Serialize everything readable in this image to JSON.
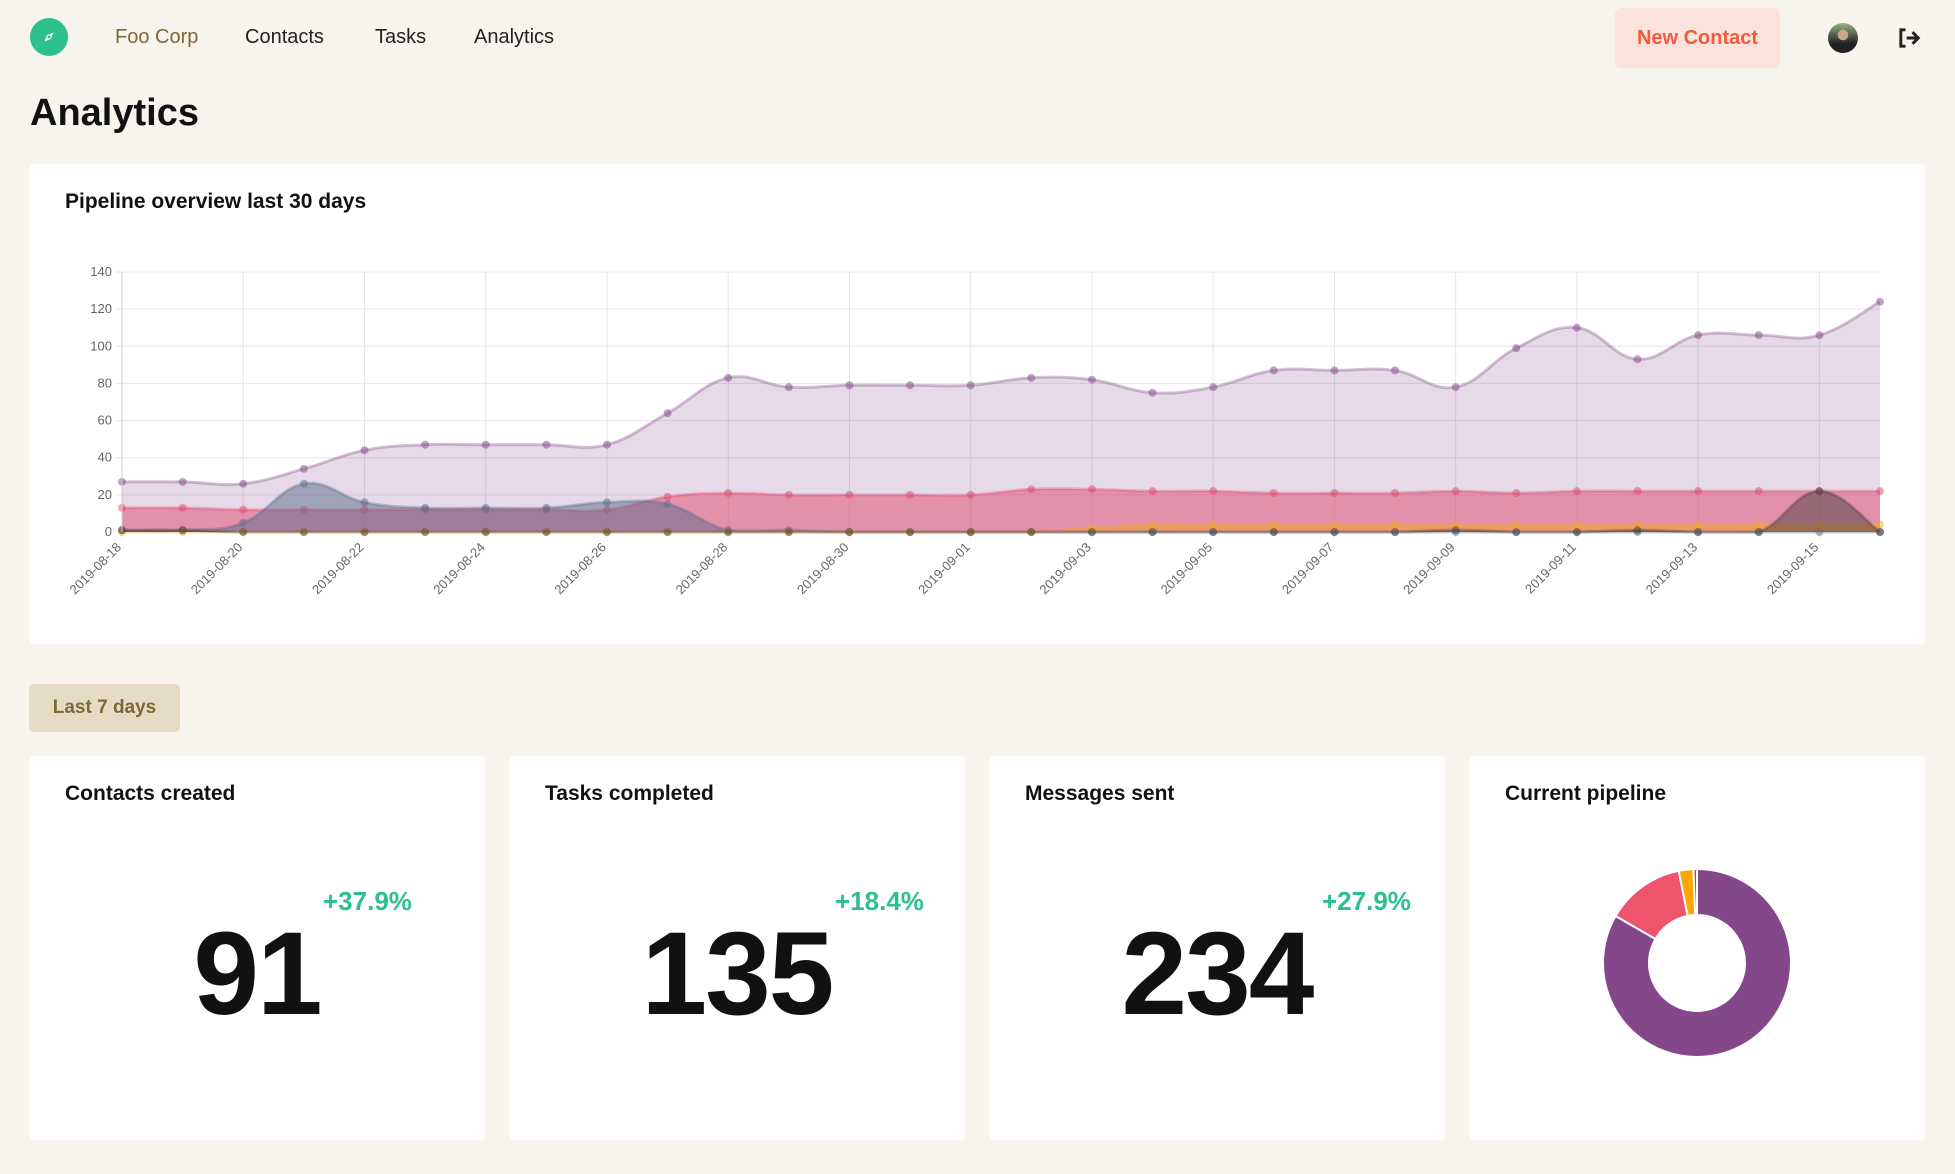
{
  "nav": {
    "brand": "Foo Corp",
    "items": [
      "Contacts",
      "Tasks",
      "Analytics"
    ],
    "new_contact": "New Contact"
  },
  "page_title": "Analytics",
  "pipeline": {
    "title": "Pipeline overview last 30 days"
  },
  "range_button": "Last 7 days",
  "stats": [
    {
      "title": "Contacts created",
      "value": "91",
      "change": "+37.9%"
    },
    {
      "title": "Tasks completed",
      "value": "135",
      "change": "+18.4%"
    },
    {
      "title": "Messages sent",
      "value": "234",
      "change": "+27.9%"
    },
    {
      "title": "Current pipeline"
    }
  ],
  "colors": {
    "accent": "#2ec08c",
    "brand": "#7d6836",
    "new_contact": "#f05a3e"
  },
  "chart_data": [
    {
      "type": "area",
      "title": "Pipeline overview last 30 days",
      "ylim": [
        0,
        140
      ],
      "yticks": [
        0,
        20,
        40,
        60,
        80,
        100,
        120,
        140
      ],
      "grid": true,
      "x": [
        "2019-08-18",
        "2019-08-19",
        "2019-08-20",
        "2019-08-21",
        "2019-08-22",
        "2019-08-23",
        "2019-08-24",
        "2019-08-25",
        "2019-08-26",
        "2019-08-27",
        "2019-08-28",
        "2019-08-29",
        "2019-08-30",
        "2019-08-31",
        "2019-09-01",
        "2019-09-02",
        "2019-09-03",
        "2019-09-04",
        "2019-09-05",
        "2019-09-06",
        "2019-09-07",
        "2019-09-08",
        "2019-09-09",
        "2019-09-10",
        "2019-09-11",
        "2019-09-12",
        "2019-09-13",
        "2019-09-14",
        "2019-09-15",
        "2019-09-16"
      ],
      "xticks": [
        "2019-08-18",
        "2019-08-20",
        "2019-08-22",
        "2019-08-24",
        "2019-08-26",
        "2019-08-28",
        "2019-08-30",
        "2019-09-01",
        "2019-09-03",
        "2019-09-05",
        "2019-09-07",
        "2019-09-09",
        "2019-09-11",
        "2019-09-13",
        "2019-09-15"
      ],
      "series": [
        {
          "color": "#84478a",
          "values": [
            27,
            27,
            26,
            34,
            44,
            47,
            47,
            47,
            47,
            64,
            83,
            78,
            79,
            79,
            79,
            83,
            82,
            75,
            78,
            87,
            87,
            87,
            78,
            99,
            110,
            93,
            106,
            106,
            106,
            124
          ]
        },
        {
          "color": "#e0476e",
          "values": [
            13,
            13,
            12,
            12,
            12,
            12,
            12,
            12,
            12,
            19,
            21,
            20,
            20,
            20,
            20,
            23,
            23,
            22,
            22,
            21,
            21,
            21,
            22,
            21,
            22,
            22,
            22,
            22,
            22,
            22
          ]
        },
        {
          "color": "#5a6b8c",
          "values": [
            1,
            1,
            5,
            26,
            16,
            13,
            13,
            13,
            16,
            15,
            1,
            1,
            0,
            0,
            0,
            0,
            0,
            0,
            0,
            0,
            0,
            0,
            0,
            0,
            0,
            0,
            0,
            0,
            0,
            0
          ]
        },
        {
          "color": "#f5a623",
          "values": [
            0,
            0,
            0,
            0,
            0,
            0,
            0,
            0,
            0,
            0,
            0,
            0,
            0,
            0,
            0,
            0,
            2,
            4,
            4,
            4,
            4,
            4,
            4,
            4,
            4,
            4,
            4,
            4,
            4,
            4
          ]
        },
        {
          "color": "#4a4040",
          "values": [
            1,
            1,
            0,
            0,
            0,
            0,
            0,
            0,
            0,
            0,
            0,
            0,
            0,
            0,
            0,
            0,
            0,
            0,
            0,
            0,
            0,
            0,
            1,
            0,
            0,
            1,
            0,
            0,
            22,
            0
          ]
        }
      ]
    },
    {
      "type": "pie",
      "donut": true,
      "title": "Current pipeline",
      "values": [
        83,
        13.5,
        2.5,
        0.6
      ],
      "colors": [
        "#84478a",
        "#ee546b",
        "#ffa600",
        "#5a6b8c"
      ]
    }
  ]
}
